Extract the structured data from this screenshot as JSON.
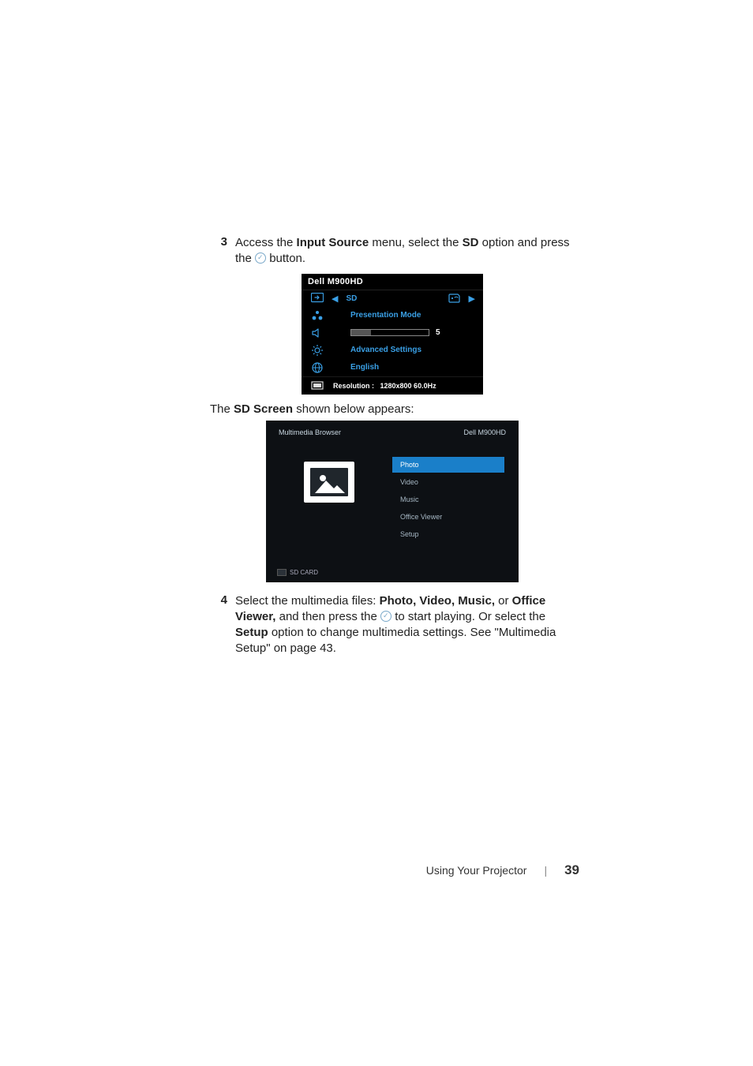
{
  "step3": {
    "number": "3",
    "text_before": "Access the ",
    "bold1": "Input Source",
    "text_mid1": " menu, select the ",
    "bold2": "SD",
    "text_mid2": " option and press the ",
    "text_after": " button."
  },
  "osd": {
    "title": "Dell  M900HD",
    "input_source_label": "SD",
    "row_presentation": "Presentation Mode",
    "slider_value": "5",
    "row_advanced": "Advanced Settings",
    "row_language": "English",
    "status_label": "Resolution :",
    "status_value": "1280x800 60.0Hz"
  },
  "caption": {
    "text_before": "The ",
    "bold": "SD Screen",
    "text_after": " shown below appears:"
  },
  "mmb": {
    "title_left": "Multimedia Browser",
    "title_right": "Dell M900HD",
    "items": [
      "Photo",
      "Video",
      "Music",
      "Office Viewer",
      "Setup"
    ],
    "selected_index": 0,
    "footer": "SD CARD"
  },
  "step4": {
    "number": "4",
    "text1": "Select the multimedia files: ",
    "bold1": "Photo, Video, Music,",
    "text2": " or ",
    "bold2": "Office Viewer,",
    "text3": " and then press the ",
    "text4": " to start playing. Or select the ",
    "bold3": "Setup",
    "text5": " option to change multimedia settings. See \"Multimedia Setup\" on page 43."
  },
  "footer": {
    "section": "Using Your Projector",
    "page": "39"
  }
}
